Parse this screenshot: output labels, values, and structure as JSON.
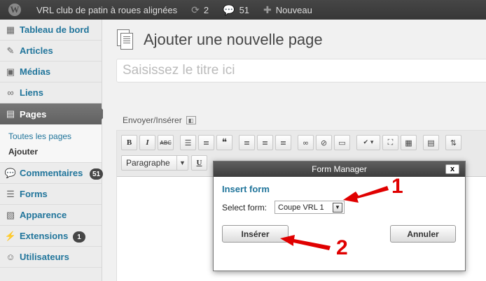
{
  "adminbar": {
    "site_name": "VRL club de patin à roues alignées",
    "updates_count": "2",
    "comments_count": "51",
    "new_label": "Nouveau"
  },
  "sidebar": {
    "items": [
      {
        "label": "Tableau de bord",
        "icon": "dashboard-icon"
      },
      {
        "label": "Articles",
        "icon": "pin-icon"
      },
      {
        "label": "Médias",
        "icon": "media-icon"
      },
      {
        "label": "Liens",
        "icon": "link-icon"
      },
      {
        "label": "Pages",
        "icon": "pages-icon"
      },
      {
        "label": "Commentaires",
        "icon": "comment-icon",
        "badge": "51"
      },
      {
        "label": "Forms",
        "icon": "forms-icon"
      },
      {
        "label": "Apparence",
        "icon": "appearance-icon"
      },
      {
        "label": "Extensions",
        "icon": "plugin-icon",
        "badge": "1"
      },
      {
        "label": "Utilisateurs",
        "icon": "users-icon"
      }
    ],
    "submenu": [
      {
        "label": "Toutes les pages"
      },
      {
        "label": "Ajouter"
      }
    ]
  },
  "main": {
    "title": "Ajouter une nouvelle page",
    "title_placeholder": "Saisissez le titre ici",
    "media_label": "Envoyer/Insérer",
    "format_select": "Paragraphe"
  },
  "dialog": {
    "title": "Form Manager",
    "close": "x",
    "heading": "Insert form",
    "select_label": "Select form:",
    "selected_form": "Coupe VRL 1",
    "insert_label": "Insérer",
    "cancel_label": "Annuler"
  },
  "annotations": {
    "one": "1",
    "two": "2"
  },
  "colors": {
    "adminbar": "#464646",
    "link": "#21759b",
    "annotation": "#e00000"
  }
}
